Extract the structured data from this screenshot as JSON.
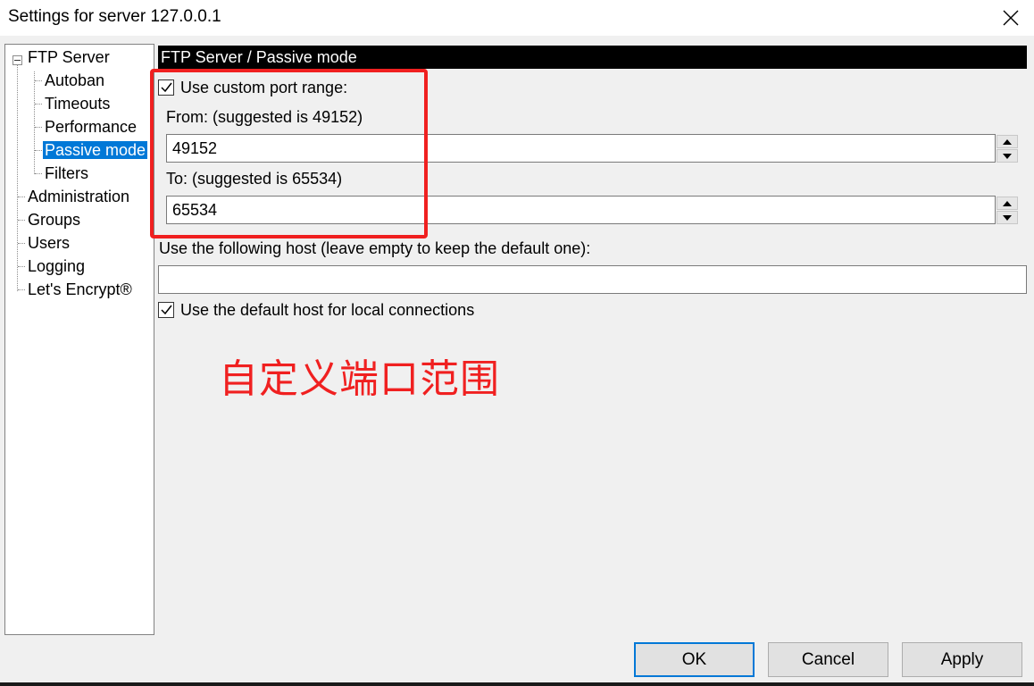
{
  "window": {
    "title": "Settings for server 127.0.0.1"
  },
  "tree": {
    "items": [
      {
        "label": "FTP Server",
        "level": 0,
        "expanded": true
      },
      {
        "label": "Autoban",
        "level": 1
      },
      {
        "label": "Timeouts",
        "level": 1
      },
      {
        "label": "Performance",
        "level": 1
      },
      {
        "label": "Passive mode",
        "level": 1,
        "selected": true
      },
      {
        "label": "Filters",
        "level": 1
      },
      {
        "label": "Administration",
        "level": 0
      },
      {
        "label": "Groups",
        "level": 0
      },
      {
        "label": "Users",
        "level": 0
      },
      {
        "label": "Logging",
        "level": 0
      },
      {
        "label": "Let's Encrypt®",
        "level": 0
      }
    ]
  },
  "page": {
    "header": "FTP Server / Passive mode",
    "custom_port_range": {
      "label": "Use custom port range:",
      "checked": true
    },
    "from": {
      "label": "From: (suggested is 49152)",
      "value": "49152"
    },
    "to": {
      "label": "To: (suggested is 65534)",
      "value": "65534"
    },
    "host": {
      "label": "Use the following host (leave empty to keep the default one):",
      "value": ""
    },
    "default_host_local": {
      "label": "Use the default host for local connections",
      "checked": true
    }
  },
  "annotation": {
    "text": "自定义端口范围",
    "color": "#f02020"
  },
  "buttons": {
    "ok": "OK",
    "cancel": "Cancel",
    "apply": "Apply"
  },
  "colors": {
    "selection": "#0078d7",
    "header_bg": "#000000",
    "annotation": "#f02020"
  }
}
